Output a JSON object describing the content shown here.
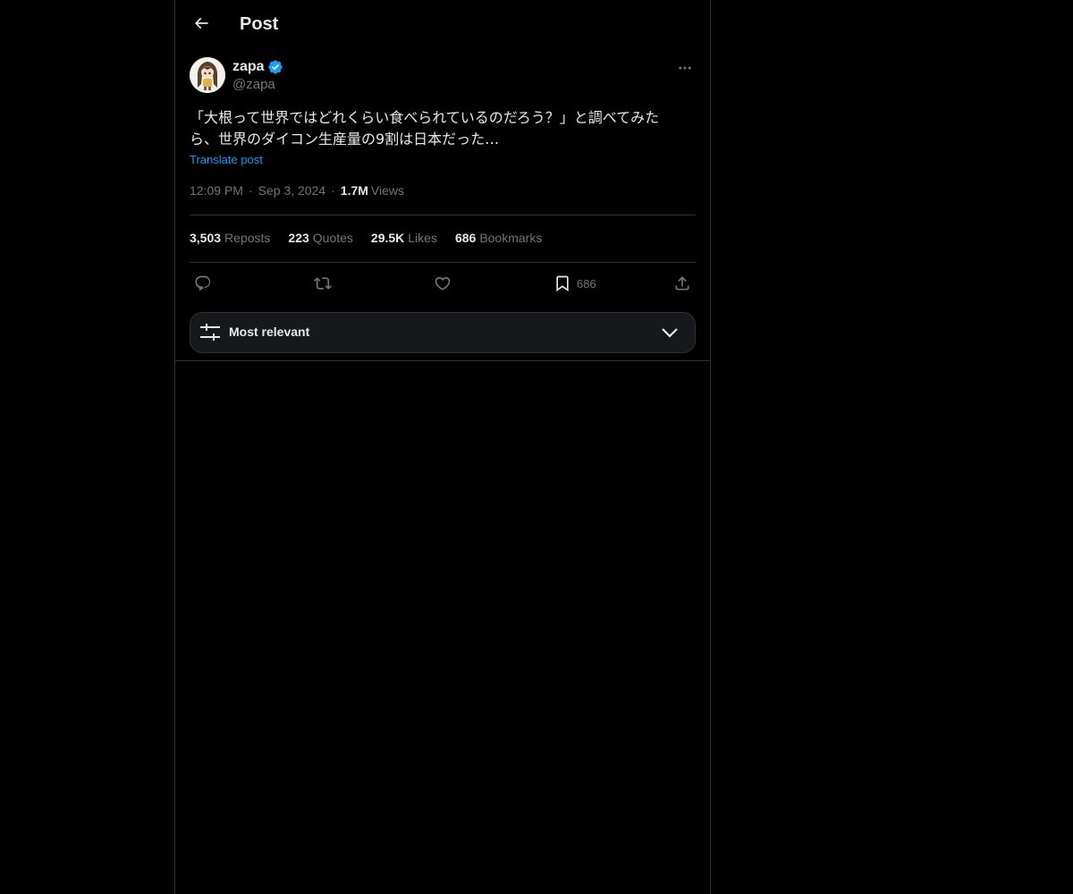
{
  "header": {
    "title": "Post"
  },
  "post": {
    "author": {
      "name": "zapa",
      "handle": "@zapa",
      "verified": true
    },
    "text_line1": "「大根って世界ではどれくらい食べられているのだろう？」と調べてみた",
    "text_line2": "ら、世界のダイコン生産量の9割は日本だった…",
    "translate_label": "Translate post",
    "time": "12:09 PM",
    "date": "Sep 3, 2024",
    "views_count": "1.7M",
    "views_label": "Views",
    "separator": "·"
  },
  "stats": {
    "reposts_count": "3,503",
    "reposts_label": "Reposts",
    "quotes_count": "223",
    "quotes_label": "Quotes",
    "likes_count": "29.5K",
    "likes_label": "Likes",
    "bookmarks_count": "686",
    "bookmarks_label": "Bookmarks"
  },
  "actions": {
    "bookmark_count": "686"
  },
  "sort": {
    "label": "Most relevant"
  },
  "colors": {
    "background": "#000000",
    "text": "#e7e9ea",
    "muted": "#71767b",
    "accent": "#1d9bf0",
    "border": "#2f3336"
  },
  "icons": [
    "back-arrow-icon",
    "verified-badge-icon",
    "more-icon",
    "reply-icon",
    "repost-icon",
    "like-icon",
    "bookmark-icon",
    "share-icon",
    "sliders-icon",
    "chevron-down-icon"
  ]
}
